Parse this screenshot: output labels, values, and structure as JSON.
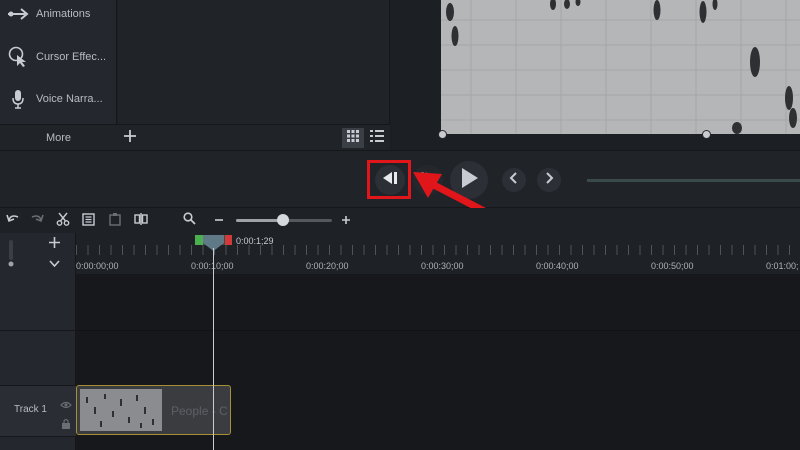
{
  "tools": {
    "items": [
      {
        "label": "Animations",
        "icon": "animations-icon"
      },
      {
        "label": "Cursor Effec...",
        "icon": "cursor-effects-icon"
      },
      {
        "label": "Voice Narra...",
        "icon": "microphone-icon"
      }
    ],
    "more_label": "More"
  },
  "timeline": {
    "playhead_time": "0:00:1;29",
    "ruler_labels": [
      "0:00:00;00",
      "0:00:10;00",
      "0:00:20;00",
      "0:00:30;00",
      "0:00:40;00",
      "0:00:50;00",
      "0:01:00;"
    ],
    "track_label": "Track 1",
    "clip_label": "People - C"
  },
  "colors": {
    "highlight": "#e0161b",
    "selection_start": "#4caf50",
    "selection_end": "#d23a3a",
    "clip_border": "#a78f35"
  }
}
